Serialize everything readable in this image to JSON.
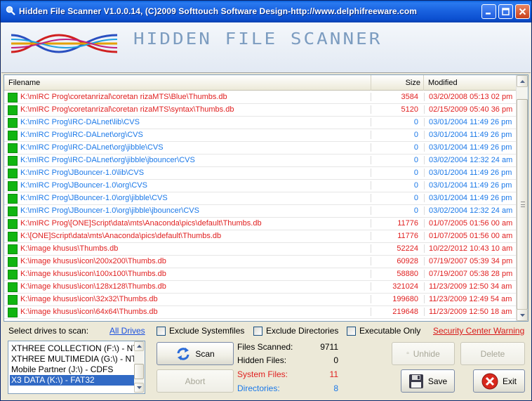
{
  "window": {
    "title": "Hidden File Scanner V1.0.0.14, (C)2009 Softtouch Software Design-http://www.delphifreeware.com",
    "banner_text": "HIDDEN FILE SCANNER"
  },
  "colors": {
    "system": "#e02020",
    "directory": "#1a78e8",
    "selection": "#316ac5"
  },
  "table": {
    "columns": [
      "Filename",
      "Size",
      "Modified"
    ],
    "rows": [
      {
        "path": "K:\\mIRC Prog\\coretanrizal\\coretan rizaMTS\\Blue\\Thumbs.db",
        "size": "3584",
        "modified": "03/20/2008 05:13 02 pm",
        "kind": "red"
      },
      {
        "path": "K:\\mIRC Prog\\coretanrizal\\coretan rizaMTS\\syntax\\Thumbs.db",
        "size": "5120",
        "modified": "02/15/2009 05:40 36 pm",
        "kind": "red"
      },
      {
        "path": "K:\\mIRC Prog\\IRC-DALnet\\lib\\CVS",
        "size": "0",
        "modified": "03/01/2004 11:49 26 pm",
        "kind": "blue"
      },
      {
        "path": "K:\\mIRC Prog\\IRC-DALnet\\org\\CVS",
        "size": "0",
        "modified": "03/01/2004 11:49 26 pm",
        "kind": "blue"
      },
      {
        "path": "K:\\mIRC Prog\\IRC-DALnet\\org\\jibble\\CVS",
        "size": "0",
        "modified": "03/01/2004 11:49 26 pm",
        "kind": "blue"
      },
      {
        "path": "K:\\mIRC Prog\\IRC-DALnet\\org\\jibble\\jbouncer\\CVS",
        "size": "0",
        "modified": "03/02/2004 12:32 24 am",
        "kind": "blue"
      },
      {
        "path": "K:\\mIRC Prog\\JBouncer-1.0\\lib\\CVS",
        "size": "0",
        "modified": "03/01/2004 11:49 26 pm",
        "kind": "blue"
      },
      {
        "path": "K:\\mIRC Prog\\JBouncer-1.0\\org\\CVS",
        "size": "0",
        "modified": "03/01/2004 11:49 26 pm",
        "kind": "blue"
      },
      {
        "path": "K:\\mIRC Prog\\JBouncer-1.0\\org\\jibble\\CVS",
        "size": "0",
        "modified": "03/01/2004 11:49 26 pm",
        "kind": "blue"
      },
      {
        "path": "K:\\mIRC Prog\\JBouncer-1.0\\org\\jibble\\jbouncer\\CVS",
        "size": "0",
        "modified": "03/02/2004 12:32 24 am",
        "kind": "blue"
      },
      {
        "path": "K:\\mIRC Prog\\[ONE]Script\\data\\mts\\Anaconda\\pics\\default\\Thumbs.db",
        "size": "11776",
        "modified": "01/07/2005 01:56 00 am",
        "kind": "red"
      },
      {
        "path": "K:\\[ONE]Script\\data\\mts\\Anaconda\\pics\\default\\Thumbs.db",
        "size": "11776",
        "modified": "01/07/2005 01:56 00 am",
        "kind": "red"
      },
      {
        "path": "K:\\image khusus\\Thumbs.db",
        "size": "52224",
        "modified": "10/22/2012 10:43 10 am",
        "kind": "red"
      },
      {
        "path": "K:\\image khusus\\icon\\200x200\\Thumbs.db",
        "size": "60928",
        "modified": "07/19/2007 05:39 34 pm",
        "kind": "red"
      },
      {
        "path": "K:\\image khusus\\icon\\100x100\\Thumbs.db",
        "size": "58880",
        "modified": "07/19/2007 05:38 28 pm",
        "kind": "red"
      },
      {
        "path": "K:\\image khusus\\icon\\128x128\\Thumbs.db",
        "size": "321024",
        "modified": "11/23/2009 12:50 34 am",
        "kind": "red"
      },
      {
        "path": "K:\\image khusus\\icon\\32x32\\Thumbs.db",
        "size": "199680",
        "modified": "11/23/2009 12:49 54 am",
        "kind": "red"
      },
      {
        "path": "K:\\image khusus\\icon\\64x64\\Thumbs.db",
        "size": "219648",
        "modified": "11/23/2009 12:50 18 am",
        "kind": "red"
      }
    ]
  },
  "controls": {
    "select_drives_label": "Select drives to scan:",
    "all_drives_link": "All Drives",
    "exclude_system": "Exclude Systemfiles",
    "exclude_dirs": "Exclude Directories",
    "executable_only": "Executable Only",
    "security_link": "Security Center Warning",
    "drives": [
      "XTHREE COLLECTION (F:\\) - NT",
      "XTHREE MULTIMEDIA (G:\\) - NT",
      "Mobile Partner (J:\\) - CDFS",
      "X3 DATA (K:\\) - FAT32"
    ],
    "selected_drive_index": 3,
    "scan": "Scan",
    "abort": "Abort",
    "unhide": "Unhide",
    "delete": "Delete",
    "save": "Save",
    "exit": "Exit"
  },
  "stats": {
    "files_scanned_label": "Files Scanned:",
    "files_scanned": "9711",
    "hidden_files_label": "Hidden Files:",
    "hidden_files": "0",
    "system_files_label": "System Files:",
    "system_files": "11",
    "directories_label": "Directories:",
    "directories": "8"
  }
}
